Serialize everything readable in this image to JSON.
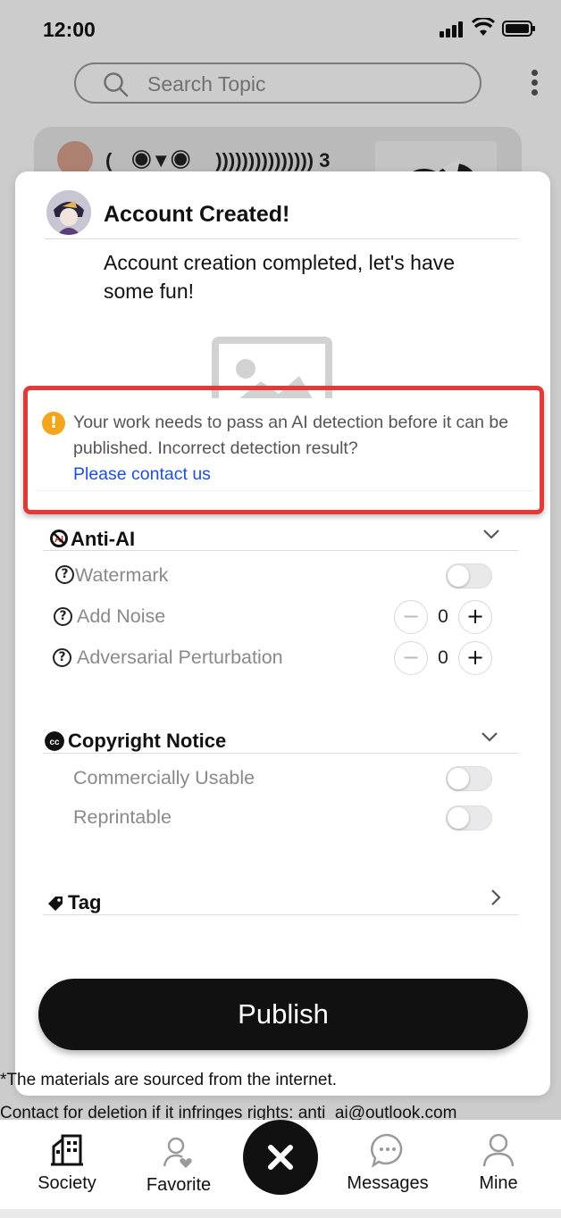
{
  "status_bar": {
    "time": "12:00"
  },
  "search": {
    "placeholder": "Search Topic"
  },
  "feed": {
    "title": "(　◉▼◉　 ))))))))))))))) 3"
  },
  "modal": {
    "title": "Account Created!",
    "message": "Account creation completed, let's have some fun!",
    "notice": {
      "text": "Your work needs to pass an AI detection before it can be published. Incorrect detection result?",
      "link": "Please contact us",
      "icon": "warning-icon",
      "icon_glyph": "!",
      "color": "#f1a61b"
    },
    "anti_ai": {
      "title": "Anti-AI",
      "watermark_label": "Watermark",
      "watermark_on": false,
      "noise_label": "Add Noise",
      "noise_value": "0",
      "perturbation_label": "Adversarial Perturbation",
      "perturbation_value": "0"
    },
    "copyright": {
      "title": "Copyright Notice",
      "commercial_label": "Commercially Usable",
      "commercial_on": false,
      "reprint_label": "Reprintable",
      "reprint_on": false
    },
    "tag": {
      "title": "Tag"
    },
    "publish_label": "Publish",
    "help_glyph": "?",
    "minus_glyph": "−",
    "plus_glyph": "+"
  },
  "footer": {
    "line1": "*The materials are sourced from the internet.",
    "line2": "Contact for deletion if it infringes rights: anti_ai@outlook.com"
  },
  "tabs": {
    "society": "Society",
    "favorite": "Favorite",
    "messages": "Messages",
    "mine": "Mine"
  },
  "colors": {
    "accent": "#111111",
    "link": "#1d4fd7",
    "highlight_box": "#e23a35"
  }
}
